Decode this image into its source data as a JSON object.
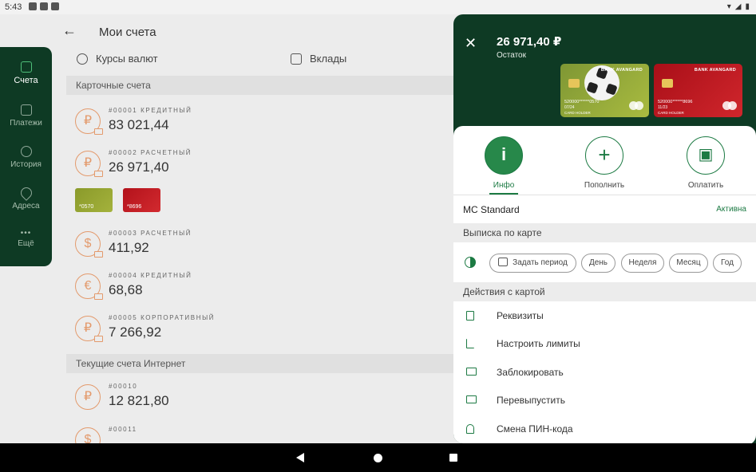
{
  "status_bar": {
    "time": "5:43"
  },
  "header": {
    "back_icon": "arrow-left-icon",
    "title": "Мои счета"
  },
  "top_nav": [
    {
      "label": "Курсы валют",
      "icon": "currency-exchange-icon"
    },
    {
      "label": "Вклады",
      "icon": "deposit-icon"
    }
  ],
  "sidebar": {
    "items": [
      {
        "label": "Счета",
        "icon": "home-icon",
        "active": true
      },
      {
        "label": "Платежи",
        "icon": "wallet-icon"
      },
      {
        "label": "История",
        "icon": "history-icon"
      },
      {
        "label": "Адреса",
        "icon": "location-icon"
      },
      {
        "label": "Ещё",
        "icon": "more-icon"
      }
    ]
  },
  "sections": [
    {
      "title": "Карточные счета",
      "accounts": [
        {
          "number": "#00001 КРЕДИТНЫЙ",
          "amount": "83 021,44",
          "currency_symbol": "₽"
        },
        {
          "number": "#00002 РАСЧЕТНЫЙ",
          "amount": "26 971,40",
          "currency_symbol": "₽"
        },
        {
          "number": "#00003 РАСЧЕТНЫЙ",
          "amount": "411,92",
          "currency_symbol": "$"
        },
        {
          "number": "#00004 КРЕДИТНЫЙ",
          "amount": "68,68",
          "currency_symbol": "€"
        },
        {
          "number": "#00005 КОРПОРАТИВНЫЙ",
          "amount": "7 266,92",
          "currency_symbol": "₽"
        }
      ]
    },
    {
      "title": "Текущие счета Интернет",
      "accounts": [
        {
          "number": "#00010",
          "amount": "12 821,80",
          "currency_symbol": "₽"
        },
        {
          "number": "#00011",
          "amount": "",
          "currency_symbol": "$"
        }
      ]
    }
  ],
  "mini_cards": [
    {
      "label": "*0570",
      "color": "#9aab35"
    },
    {
      "label": "*8696",
      "color": "#c31c23"
    }
  ],
  "panel": {
    "close_icon": "close-icon",
    "balance": "26 971,40 ₽",
    "balance_label": "Остаток",
    "cards": [
      {
        "bank": "BANK AVANGARD",
        "number": "520000******0570",
        "expiry": "07/24",
        "holder": "CARD HOLDER"
      },
      {
        "bank": "BANK AVANGARD",
        "number": "520000******8696",
        "expiry": "11/23",
        "holder": "CARD HOLDER"
      }
    ],
    "actions": [
      {
        "label": "Инфо",
        "glyph": "i",
        "icon": "info-icon",
        "active": true
      },
      {
        "label": "Пополнить",
        "glyph": "+",
        "icon": "plus-icon"
      },
      {
        "label": "Оплатить",
        "glyph": "▣",
        "icon": "wallet-icon"
      }
    ],
    "card_name": "MC Standard",
    "card_status": "Активна",
    "statement": {
      "title": "Выписка по карте",
      "period_button": "Задать период",
      "filters": [
        "День",
        "Неделя",
        "Месяц",
        "Год"
      ]
    },
    "card_actions": {
      "title": "Действия с картой",
      "items": [
        {
          "label": "Реквизиты",
          "icon": "document-icon"
        },
        {
          "label": "Настроить лимиты",
          "icon": "limit-icon"
        },
        {
          "label": "Заблокировать",
          "icon": "card-lock-icon"
        },
        {
          "label": "Перевыпустить",
          "icon": "card-reissue-icon"
        },
        {
          "label": "Смена ПИН-кода",
          "icon": "lock-icon"
        }
      ]
    }
  },
  "colors": {
    "primary_dark": "#0e3a24",
    "accent": "#1c7a43",
    "account_icon": "#e39a6c"
  }
}
